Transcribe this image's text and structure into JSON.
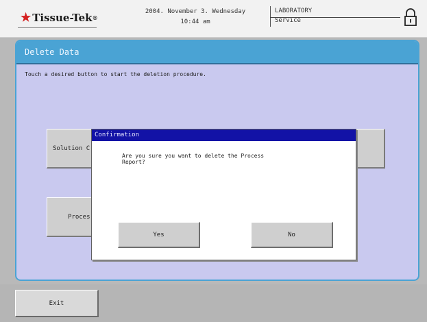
{
  "header": {
    "brand": "Tissue-Tek",
    "brand_mark": "®",
    "date": "2004. November 3. Wednesday",
    "time": "10:44 am",
    "mode": "LABORATORY",
    "user": "Service"
  },
  "panel": {
    "title": "Delete Data",
    "instruction": "Touch a desired button to start the deletion procedure.",
    "buttons": [
      {
        "label": "Solution C"
      },
      {
        "label": "Proces"
      },
      {
        "label": ""
      }
    ]
  },
  "dialog": {
    "title": "Confirmation",
    "message_line1": "Are you sure you want to delete the Process",
    "message_line2": "Report?",
    "yes_label": "Yes",
    "no_label": "No"
  },
  "footer": {
    "exit_label": "Exit"
  },
  "colors": {
    "panel_bg": "#c9c9ef",
    "panel_title": "#4aa3d4",
    "dialog_title": "#1212a6",
    "brand_star": "#d42020"
  },
  "icons": {
    "brand": "star-icon",
    "lock": "key-lock-icon"
  }
}
